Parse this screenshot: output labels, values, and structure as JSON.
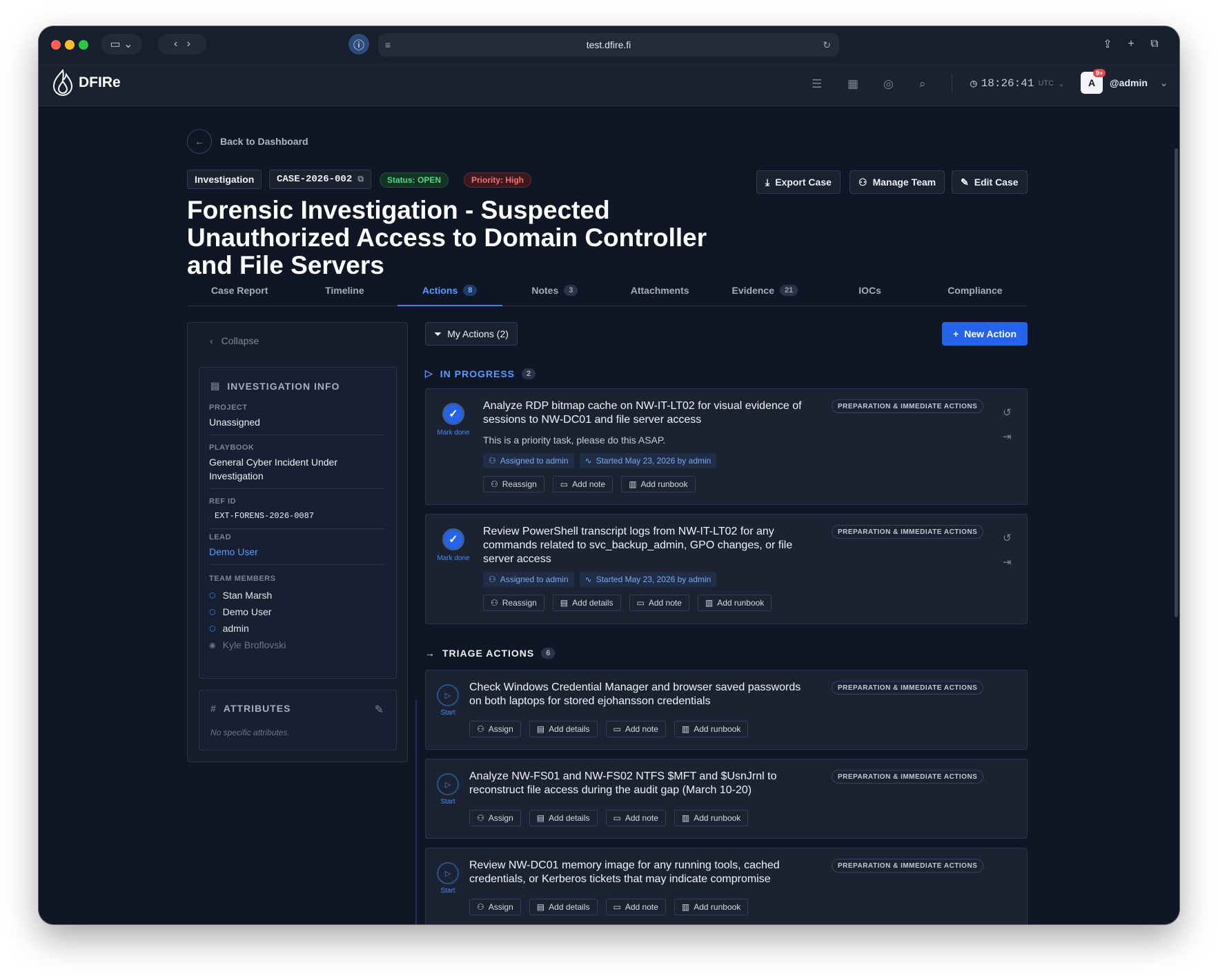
{
  "browser": {
    "url": "test.dfire.fi"
  },
  "app": {
    "name": "DFIRe",
    "time": "18:26:41",
    "timezone": "UTC",
    "notif_count": "9+",
    "avatar_letter": "A",
    "user": "@admin"
  },
  "back_label": "Back to Dashboard",
  "case": {
    "type": "Investigation",
    "id": "CASE-2026-002",
    "status": "Status: OPEN",
    "priority": "Priority: High",
    "title": "Forensic Investigation - Suspected Unauthorized Access to Domain Controller and File Servers"
  },
  "header_buttons": {
    "export": "Export Case",
    "team": "Manage Team",
    "edit": "Edit Case"
  },
  "tabs": [
    {
      "label": "Case Report",
      "count": ""
    },
    {
      "label": "Timeline",
      "count": ""
    },
    {
      "label": "Actions",
      "count": "8"
    },
    {
      "label": "Notes",
      "count": "3"
    },
    {
      "label": "Attachments",
      "count": ""
    },
    {
      "label": "Evidence",
      "count": "21"
    },
    {
      "label": "IOCs",
      "count": ""
    },
    {
      "label": "Compliance",
      "count": ""
    }
  ],
  "sidebar": {
    "collapse": "Collapse",
    "info_title": "INVESTIGATION INFO",
    "project_label": "PROJECT",
    "project": "Unassigned",
    "playbook_label": "PLAYBOOK",
    "playbook": "General Cyber Incident Under Investigation",
    "ref_label": "REF ID",
    "ref": "EXT-FORENS-2026-0087",
    "lead_label": "LEAD",
    "lead": "Demo User",
    "team_label": "TEAM MEMBERS",
    "members": [
      "Stan Marsh",
      "Demo User",
      "admin",
      "Kyle Broflovski"
    ],
    "attr_title": "ATTRIBUTES",
    "attr_empty": "No specific attributes."
  },
  "toolbar": {
    "filter": "My Actions (2)",
    "new": "New Action"
  },
  "groups": {
    "in_progress": {
      "label": "IN PROGRESS",
      "count": "2"
    },
    "triage": {
      "label": "TRIAGE ACTIONS",
      "count": "6"
    }
  },
  "in_progress": [
    {
      "title": "Analyze RDP bitmap cache on NW-IT-LT02 for visual evidence of sessions to NW-DC01 and file server access",
      "tag": "PREPARATION & IMMEDIATE ACTIONS",
      "desc": "This is a priority task, please do this ASAP.",
      "assigned": "Assigned to admin",
      "started": "Started May 23, 2026 by admin",
      "mark": "Mark done",
      "actions": [
        "Reassign",
        "Add note",
        "Add runbook"
      ]
    },
    {
      "title": "Review PowerShell transcript logs from NW-IT-LT02 for any commands related to svc_backup_admin, GPO changes, or file server access",
      "tag": "PREPARATION & IMMEDIATE ACTIONS",
      "assigned": "Assigned to admin",
      "started": "Started May 23, 2026 by admin",
      "mark": "Mark done",
      "actions": [
        "Reassign",
        "Add details",
        "Add note",
        "Add runbook"
      ]
    }
  ],
  "triage": [
    {
      "title": "Check Windows Credential Manager and browser saved passwords on both laptops for stored ejohansson credentials",
      "tag": "PREPARATION & IMMEDIATE ACTIONS",
      "start": "Start",
      "actions": [
        "Assign",
        "Add details",
        "Add note",
        "Add runbook"
      ]
    },
    {
      "title": "Analyze NW-FS01 and NW-FS02 NTFS $MFT and $UsnJrnl to reconstruct file access during the audit gap (March 10-20)",
      "tag": "PREPARATION & IMMEDIATE ACTIONS",
      "start": "Start",
      "actions": [
        "Assign",
        "Add details",
        "Add note",
        "Add runbook"
      ]
    },
    {
      "title": "Review NW-DC01 memory image for any running tools, cached credentials, or Kerberos tickets that may indicate compromise",
      "tag": "PREPARATION & IMMEDIATE ACTIONS",
      "start": "Start",
      "actions": [
        "Assign",
        "Add details",
        "Add note",
        "Add runbook"
      ]
    }
  ],
  "colors": {
    "accent": "#3b82f6",
    "bg": "#0f1626",
    "status_open": "#4ade80",
    "priority_high": "#f87171"
  }
}
